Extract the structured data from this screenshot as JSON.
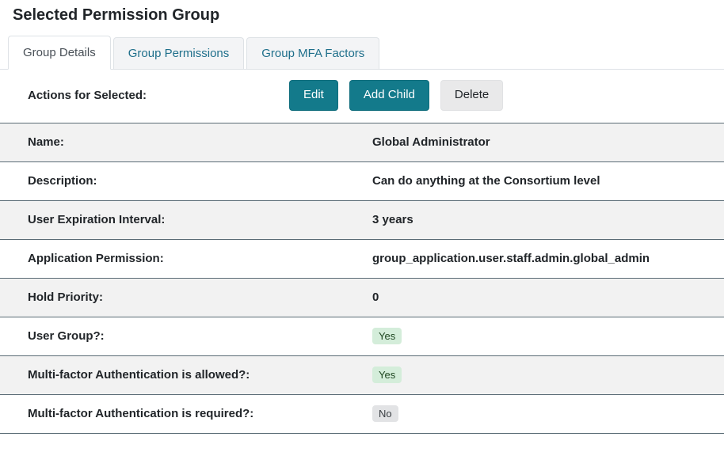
{
  "page": {
    "title": "Selected Permission Group"
  },
  "tabs": [
    {
      "label": "Group Details",
      "active": true
    },
    {
      "label": "Group Permissions",
      "active": false
    },
    {
      "label": "Group MFA Factors",
      "active": false
    }
  ],
  "actions": {
    "label": "Actions for Selected:",
    "buttons": [
      {
        "label": "Edit",
        "style": "teal"
      },
      {
        "label": "Add Child",
        "style": "teal"
      },
      {
        "label": "Delete",
        "style": "light"
      }
    ]
  },
  "details": {
    "rows": [
      {
        "label": "Name:",
        "value": "Global Administrator",
        "type": "text"
      },
      {
        "label": "Description:",
        "value": "Can do anything at the Consortium level",
        "type": "text"
      },
      {
        "label": "User Expiration Interval:",
        "value": "3 years",
        "type": "text"
      },
      {
        "label": "Application Permission:",
        "value": "group_application.user.staff.admin.global_admin",
        "type": "text"
      },
      {
        "label": "Hold Priority:",
        "value": "0",
        "type": "text"
      },
      {
        "label": "User Group?:",
        "value": "Yes",
        "type": "badge",
        "badge": "success"
      },
      {
        "label": "Multi-factor Authentication is allowed?:",
        "value": "Yes",
        "type": "badge",
        "badge": "success"
      },
      {
        "label": "Multi-factor Authentication is required?:",
        "value": "No",
        "type": "badge",
        "badge": "secondary"
      }
    ]
  },
  "colors": {
    "accent_teal": "#137a8b",
    "tab_link": "#1f6f8b",
    "row_stripe": "#f2f2f2",
    "row_border": "#5a6b75",
    "badge_success_bg": "#d4edda",
    "badge_secondary_bg": "#e2e3e5"
  }
}
